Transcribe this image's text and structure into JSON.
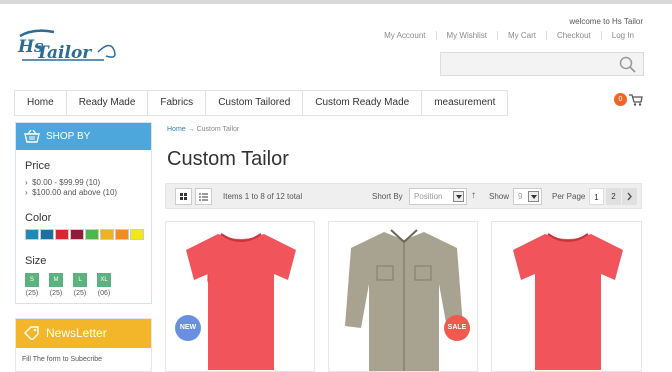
{
  "header": {
    "welcome": "welcome to Hs Tailor",
    "links": [
      "My Account",
      "My Wishlist",
      "My Cart",
      "Checkout",
      "Log In"
    ],
    "logo_text": "Hs Tailor"
  },
  "nav": {
    "items": [
      "Home",
      "Ready Made",
      "Fabrics",
      "Custom Tailored",
      "Custom Ready Made",
      "measurement"
    ],
    "cart_count": "0"
  },
  "sidebar": {
    "shop_by": "SHOP BY",
    "price_title": "Price",
    "price_options": [
      "$0.00 - $99.99 (10)",
      "$100.00 and above (10)"
    ],
    "color_title": "Color",
    "colors": [
      "#1f8bb5",
      "#1d6fa0",
      "#d9262e",
      "#8e1d3c",
      "#4db848",
      "#f2b21e",
      "#f28c1d",
      "#f4e61c"
    ],
    "size_title": "Size",
    "sizes": [
      {
        "label": "S",
        "count": "(25)"
      },
      {
        "label": "M",
        "count": "(25)"
      },
      {
        "label": "L",
        "count": "(25)"
      },
      {
        "label": "XL",
        "count": "(06)"
      }
    ],
    "newsletter_title": "NewsLetter",
    "newsletter_text": "Fill The form to Subecribe"
  },
  "main": {
    "breadcrumb_home": "Home",
    "breadcrumb_sep": "→",
    "breadcrumb_current": "Custom Tailor",
    "title": "Custom Tailor",
    "toolbar": {
      "items_text": "Items 1 to 8 of 12 total",
      "sort_label": "Short By",
      "sort_value": "Position",
      "show_label": "Show",
      "show_value": "9",
      "per_page_label": "Per Page",
      "pages": [
        "1",
        "2"
      ]
    },
    "products": [
      {
        "badge": "NEW",
        "badge_color": "#6b8fe0",
        "shirt_color": "#f2545b"
      },
      {
        "badge": "SALE",
        "badge_color": "#ef5a4f",
        "shirt_color": "#a8a391"
      },
      {
        "badge": "",
        "badge_color": "",
        "shirt_color": "#f2545b"
      }
    ]
  }
}
